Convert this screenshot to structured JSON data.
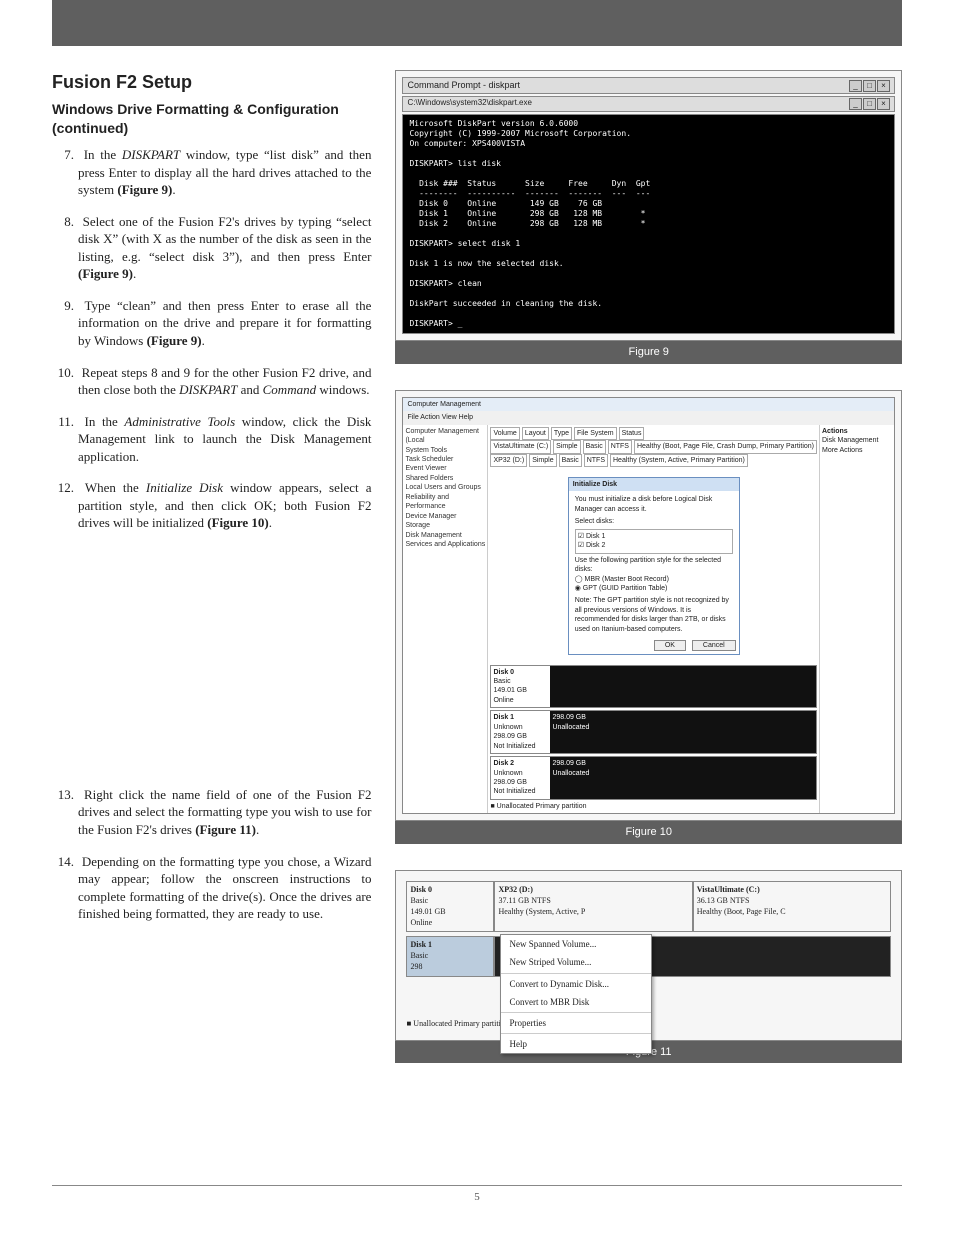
{
  "page": {
    "number": "5"
  },
  "headings": {
    "h1": "Fusion F2 Setup",
    "h2": "Windows Drive Formatting & Configuration (continued)"
  },
  "steps": [
    {
      "n": "7.",
      "text": "In the <span class=\"em\">DISKPART</span> window, type “list disk” and then press Enter to display all the hard drives attached to the system <span class=\"bold\">(Figure 9)</span>."
    },
    {
      "n": "8.",
      "text": "Select one of the Fusion F2's drives by typing “select disk X” (with X as the number of the disk as seen in the listing, e.g. “select disk 3”), and then press Enter <span class=\"bold\">(Figure 9)</span>."
    },
    {
      "n": "9.",
      "text": "Type “clean” and then press Enter to erase all the information on the drive and prepare it for formatting by Windows <span class=\"bold\">(Figure 9)</span>."
    },
    {
      "n": "10.",
      "text": "Repeat steps 8 and 9 for the other Fusion F2 drive, and then close both the <span class=\"em\">DISKPART</span> and <span class=\"em\">Command</span> windows."
    },
    {
      "n": "11.",
      "text": "In the <span class=\"em\">Administrative Tools</span> window, click the Disk Management link to launch the Disk Management application."
    },
    {
      "n": "12.",
      "text": "When the <span class=\"em\">Initialize Disk</span> window appears, select a partition style, and then click OK; both Fusion F2 drives will be initialized <span class=\"bold\">(Figure 10)</span>."
    },
    {
      "n": "13.",
      "text": "Right click the name field of one of the Fusion F2 drives and select the formatting type you wish to use for the Fusion F2's drives <span class=\"bold\">(Figure 11)</span>."
    },
    {
      "n": "14.",
      "text": "Depending on the formatting type you chose, a Wizard may appear; follow the onscreen instructions to complete formatting of the drive(s). Once the drives are finished being formatted, they are ready to use."
    }
  ],
  "fig9": {
    "caption": "Figure 9",
    "window_title": "Command Prompt - diskpart",
    "sub_title": "C:\\Windows\\system32\\diskpart.exe",
    "console_text": "Microsoft DiskPart version 6.0.6000\nCopyright (C) 1999-2007 Microsoft Corporation.\nOn computer: XPS400VISTA\n\nDISKPART> list disk\n\n  Disk ###  Status      Size     Free     Dyn  Gpt\n  --------  ----------  -------  -------  ---  ---\n  Disk 0    Online       149 GB    76 GB\n  Disk 1    Online       298 GB   128 MB        *\n  Disk 2    Online       298 GB   128 MB        *\n\nDISKPART> select disk 1\n\nDisk 1 is now the selected disk.\n\nDISKPART> clean\n\nDiskPart succeeded in cleaning the disk.\n\nDISKPART> _"
  },
  "fig10": {
    "caption": "Figure 10",
    "window_title": "Computer Management",
    "menu": "File   Action   View   Help",
    "nav": "Computer Management (Local\n  System Tools\n    Task Scheduler\n    Event Viewer\n    Shared Folders\n    Local Users and Groups\n    Reliability and Performance\n    Device Manager\n  Storage\n    Disk Management\n  Services and Applications",
    "table_header": [
      "Volume",
      "Layout",
      "Type",
      "File System",
      "Status"
    ],
    "table_rows": [
      [
        "VistaUltimate (C:)",
        "Simple",
        "Basic",
        "NTFS",
        "Healthy (Boot, Page File, Crash Dump, Primary Partition)"
      ],
      [
        "XP32 (D:)",
        "Simple",
        "Basic",
        "NTFS",
        "Healthy (System, Active, Primary Partition)"
      ]
    ],
    "actions_header": "Actions",
    "actions": [
      "Disk Management",
      "More Actions"
    ],
    "dialog": {
      "title": "Initialize Disk",
      "body1": "You must initialize a disk before Logical Disk Manager can access it.",
      "body2": "Select disks:",
      "disks": [
        "Disk 1",
        "Disk 2"
      ],
      "body3": "Use the following partition style for the selected disks:",
      "opt1": "MBR (Master Boot Record)",
      "opt2": "GPT (GUID Partition Table)",
      "note": "Note: The GPT partition style is not recognized by all previous versions of Windows. It is recommended for disks larger than 2TB, or disks used on Itanium-based computers.",
      "ok": "OK",
      "cancel": "Cancel"
    },
    "panes": [
      {
        "title": "Disk 0",
        "sub": "Basic\n149.01 GB\nOnline"
      },
      {
        "title": "Disk 1",
        "sub": "Unknown\n298.09 GB\nNot Initialized",
        "right": "298.09 GB\nUnallocated"
      },
      {
        "title": "Disk 2",
        "sub": "Unknown\n298.09 GB\nNot Initialized",
        "right": "298.09 GB\nUnallocated"
      }
    ],
    "legend": "Unallocated   Primary partition"
  },
  "fig11": {
    "caption": "Figure 11",
    "disk0": {
      "label": "Disk 0",
      "sub": "Basic\n149.01 GB\nOnline",
      "p1_title": "XP32 (D:)",
      "p1_sub": "37.11 GB NTFS\nHealthy (System, Active, P",
      "p2_title": "VistaUltimate (C:)",
      "p2_sub": "36.13 GB NTFS\nHealthy (Boot, Page File, C"
    },
    "disk1": {
      "label": "Disk 1",
      "sub": "Basic\n298"
    },
    "menu": [
      "New Spanned Volume...",
      "New Striped Volume...",
      "__sep__",
      "Convert to Dynamic Disk...",
      "Convert to MBR Disk",
      "__sep__",
      "Properties",
      "__sep__",
      "Help"
    ],
    "legend": "Unallocated   Primary partition"
  }
}
